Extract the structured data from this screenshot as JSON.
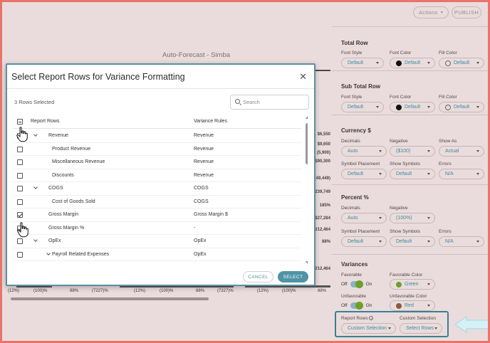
{
  "toolbar": {
    "actions_label": "Actions",
    "publish_label": "PUBLISH"
  },
  "report": {
    "title": "Auto-Forecast - Simba",
    "side_values": [
      "$6,550",
      "$9,650",
      "(5,900)",
      "$90,300",
      "(49,449)",
      "239,749",
      "185%",
      "$27,284",
      "212,464",
      "88%",
      "212,464"
    ],
    "bottom_row": [
      "(12%)",
      "(100)%",
      "88%",
      "(7227)%",
      "(12%)",
      "(100)%",
      "88%",
      "(7227)%",
      "(12%)",
      "(100)%",
      "88%"
    ]
  },
  "panel": {
    "total_row": {
      "title": "Total Row",
      "font_style_label": "Font Style",
      "font_style_value": "Default",
      "font_color_label": "Font Color",
      "font_color_value": "Default",
      "fill_color_label": "Fill Color",
      "fill_color_value": "Default"
    },
    "sub_total_row": {
      "title": "Sub Total Row",
      "font_style_label": "Font Style",
      "font_style_value": "Default",
      "font_color_label": "Font Color",
      "font_color_value": "Default",
      "fill_color_label": "Fill Color",
      "fill_color_value": "Default"
    },
    "currency": {
      "title": "Currency $",
      "decimals_label": "Decimals",
      "decimals_value": "Auto",
      "negative_label": "Negative",
      "negative_value": "($100)",
      "show_as_label": "Show As",
      "show_as_value": "Actual",
      "symbol_placement_label": "Symbol Placement",
      "symbol_placement_value": "Default",
      "show_symbols_label": "Show Symbols",
      "show_symbols_value": "Default",
      "errors_label": "Errors",
      "errors_value": "N/A"
    },
    "percent": {
      "title": "Percent %",
      "decimals_label": "Decimals",
      "decimals_value": "Auto",
      "negative_label": "Negative",
      "negative_value": "(100%)",
      "symbol_placement_label": "Symbol Placement",
      "symbol_placement_value": "Default",
      "show_symbols_label": "Show Symbols",
      "show_symbols_value": "Default",
      "errors_label": "Errors",
      "errors_value": "N/A"
    },
    "variances": {
      "title": "Variances",
      "favorable_label": "Favorable",
      "favorable_off": "Off",
      "favorable_on": "On",
      "favorable_color_label": "Favorable Color",
      "favorable_color_value": "Green",
      "unfavorable_label": "Unfavorable",
      "unfavorable_off": "Off",
      "unfavorable_on": "On",
      "unfavorable_color_label": "Unfavorable Color",
      "unfavorable_color_value": "Red",
      "report_rows_label": "Report Rows",
      "report_rows_value": "Custom Selection",
      "custom_selection_label": "Custom Selection",
      "custom_selection_value": "Select Rows"
    }
  },
  "modal": {
    "title": "Select Report Rows for Variance Formatting",
    "selected_count": "3 Rows Selected",
    "search_placeholder": "Search",
    "col_rows": "Report Rows",
    "col_rules": "Variance Rules",
    "rows": [
      {
        "name": "Revenue",
        "rule": "Revenue",
        "checked": true,
        "expandable": true,
        "indent": 0
      },
      {
        "name": "Product Revenue",
        "rule": "Revenue",
        "checked": false,
        "expandable": false,
        "indent": 1
      },
      {
        "name": "Miscellaneous Revenue",
        "rule": "Revenue",
        "checked": false,
        "expandable": false,
        "indent": 1
      },
      {
        "name": "Discounts",
        "rule": "Revenue",
        "checked": false,
        "expandable": false,
        "indent": 1
      },
      {
        "name": "COGS",
        "rule": "COGS",
        "checked": false,
        "expandable": true,
        "indent": 0
      },
      {
        "name": "Cost of Goods Sold",
        "rule": "COGS",
        "checked": false,
        "expandable": false,
        "indent": 1
      },
      {
        "name": "Gross Margin",
        "rule": "Gross Margin $",
        "checked": true,
        "expandable": false,
        "indent": 0
      },
      {
        "name": "Gross Margin %",
        "rule": "-",
        "checked": true,
        "expandable": false,
        "indent": 0
      },
      {
        "name": "OpEx",
        "rule": "OpEx",
        "checked": false,
        "expandable": true,
        "indent": 0
      },
      {
        "name": "Payroll Related Expenses",
        "rule": "OpEx",
        "checked": false,
        "expandable": true,
        "indent": 1
      }
    ],
    "cancel_label": "CANCEL",
    "select_label": "SELECT"
  },
  "colors": {
    "accent": "#4f93a6",
    "frame": "#e8746a",
    "favorable": "#6e9f28",
    "unfavorable": "#8b5a3c"
  }
}
